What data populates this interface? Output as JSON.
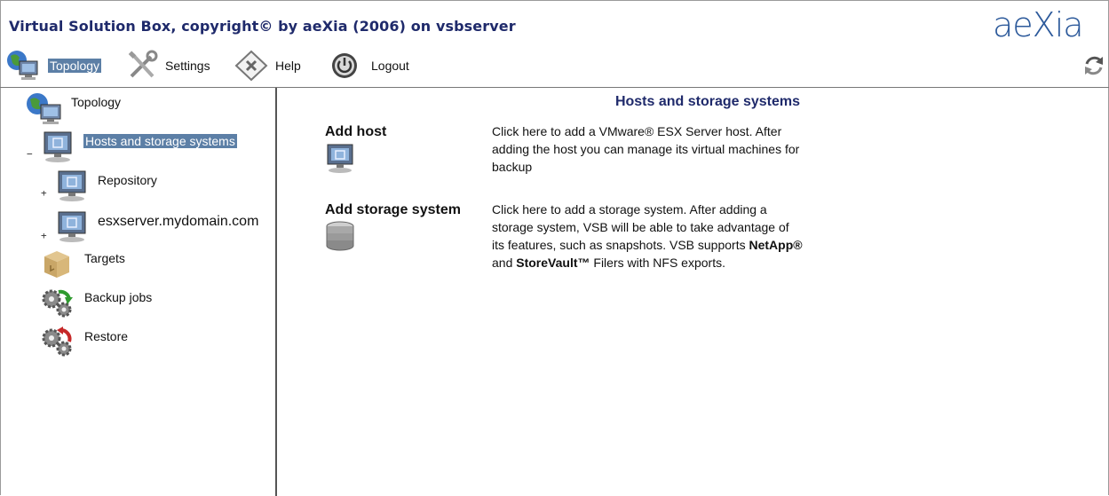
{
  "app": {
    "title": "Virtual Solution Box, copyright© by aeXia (2006) on vsbserver",
    "logo_text": "aeXia"
  },
  "toolbar": {
    "topology_label": "Topology",
    "settings_label": "Settings",
    "help_label": "Help",
    "logout_label": "Logout"
  },
  "tree": {
    "topology": "Topology",
    "hosts": "Hosts and storage systems",
    "repository": "Repository",
    "esxserver": "esxserver.mydomain.com",
    "targets": "Targets",
    "backup_jobs": "Backup jobs",
    "restore": "Restore",
    "collapse_symbol": "−",
    "expand_symbol": "+"
  },
  "main": {
    "title": "Hosts and storage systems",
    "add_host": {
      "title": "Add host",
      "description": "Click here to add a VMware® ESX Server host. After adding the host you can manage its virtual machines for backup"
    },
    "add_storage": {
      "title": "Add storage system",
      "description_part1": "Click here to add a storage system. After adding a storage system, VSB will be able to take advantage of its features, such as snapshots. VSB supports ",
      "netapp": "NetApp®",
      "and": " and ",
      "storevault": "StoreVault™",
      "description_part2": " Filers with NFS exports."
    }
  },
  "colors": {
    "title_text": "#1f2a6b",
    "selection_bg": "#5c7fa6",
    "logo": "#2d5a9b"
  },
  "icons": {
    "topology": "globe-monitor-icon",
    "settings": "tools-icon",
    "help": "help-diamond-icon",
    "logout": "power-icon",
    "refresh": "refresh-icon",
    "host": "monitor-icon",
    "storage": "database-icon",
    "targets": "box-icon",
    "backup": "gears-green-arrow-icon",
    "restore": "gears-red-arrow-icon"
  }
}
